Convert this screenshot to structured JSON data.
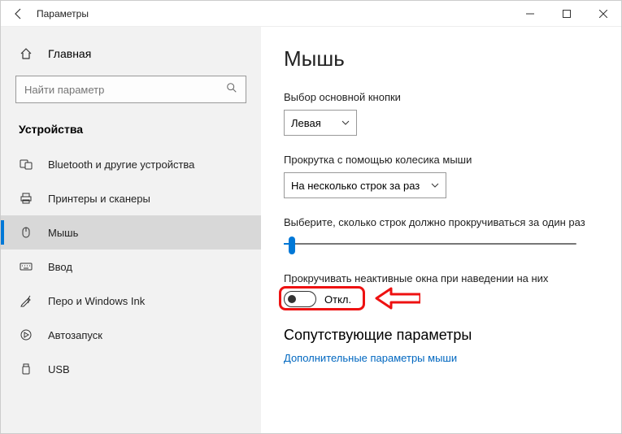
{
  "window": {
    "title": "Параметры"
  },
  "sidebar": {
    "home_label": "Главная",
    "search_placeholder": "Найти параметр",
    "section_label": "Устройства",
    "items": [
      {
        "label": "Bluetooth и другие устройства"
      },
      {
        "label": "Принтеры и сканеры"
      },
      {
        "label": "Мышь"
      },
      {
        "label": "Ввод"
      },
      {
        "label": "Перо и Windows Ink"
      },
      {
        "label": "Автозапуск"
      },
      {
        "label": "USB"
      }
    ],
    "active_index": 2
  },
  "main": {
    "title": "Мышь",
    "primary_button_label": "Выбор основной кнопки",
    "primary_button_value": "Левая",
    "scroll_wheel_label": "Прокрутка с помощью колесика мыши",
    "scroll_wheel_value": "На несколько строк за раз",
    "lines_label": "Выберите, сколько строк должно прокручиваться за один раз",
    "inactive_scroll_label": "Прокручивать неактивные окна при наведении на них",
    "toggle_state_label": "Откл.",
    "toggle_on": false,
    "related_heading": "Сопутствующие параметры",
    "related_link": "Дополнительные параметры мыши"
  }
}
